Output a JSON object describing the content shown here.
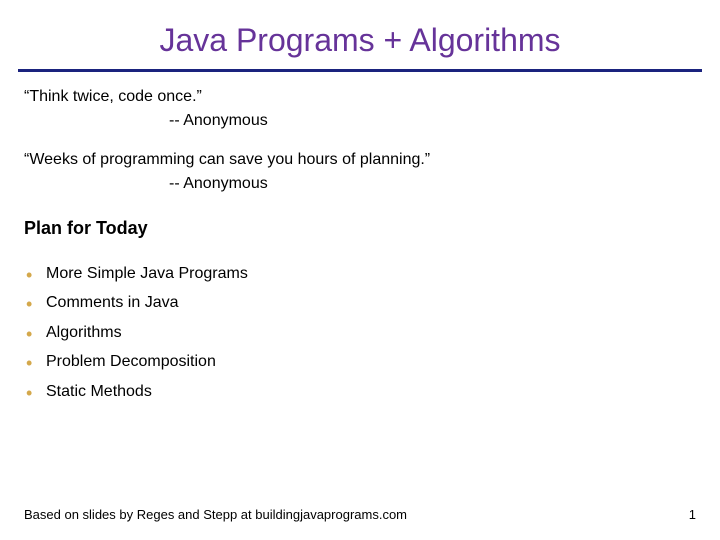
{
  "title": "Java Programs + Algorithms",
  "quote1_text": "“Think twice, code once.”",
  "quote1_attr": "-- Anonymous",
  "quote2_text": "“Weeks of programming can save you hours of planning.”",
  "quote2_attr": "-- Anonymous",
  "plan_heading": "Plan for Today",
  "bullets": [
    "More Simple Java Programs",
    "Comments in Java",
    "Algorithms",
    "Problem Decomposition",
    "Static Methods"
  ],
  "footer": "Based on slides by Reges and Stepp at buildingjavaprograms.com",
  "page_number": "1"
}
